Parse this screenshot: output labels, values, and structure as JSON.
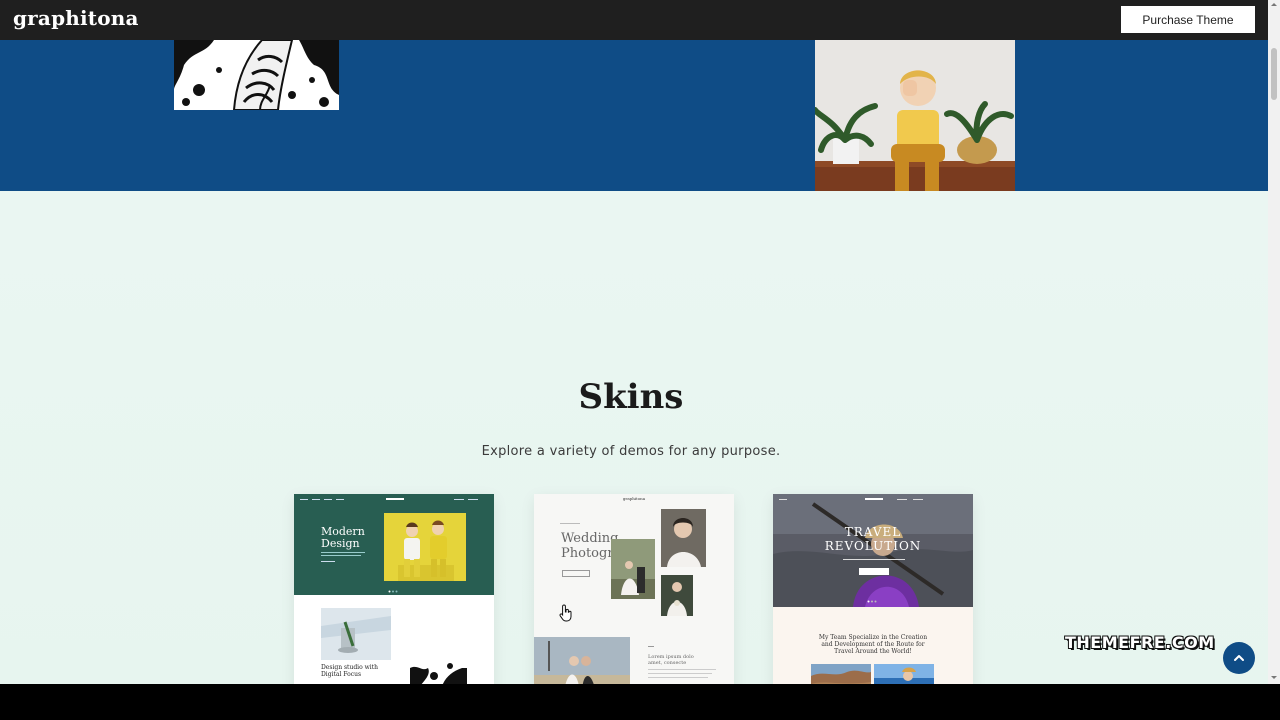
{
  "header": {
    "logo": "graphitona",
    "purchase_label": "Purchase Theme"
  },
  "section": {
    "title": "Skins",
    "subtitle": "Explore a variety of demos for any purpose."
  },
  "cards": [
    {
      "hero_title": "Modern\nDesign",
      "caption": "Design studio with\nDigital Focus"
    },
    {
      "logo": "graphitona",
      "hero_title": "Wedding\nPhotographer",
      "caption": "Lorem ipsum dolo\namet, consecte"
    },
    {
      "logo": "graphitona",
      "hero_title": "TRAVEL\nREVOLUTION",
      "heading": "My Team Specialize in the Creation\nand Development of the Route for\nTravel Around the World!"
    }
  ],
  "watermark": "THEMEFRE.COM",
  "colors": {
    "topbar": "#1f1f1f",
    "blue_band": "#0f4c86",
    "section_bg": "#e9f6f1",
    "modern_design_green": "#285e52",
    "accent_blue": "#0f4c86"
  },
  "icons": {
    "back_to_top": "chevron-up-icon",
    "cursor": "hand-pointer-icon"
  }
}
